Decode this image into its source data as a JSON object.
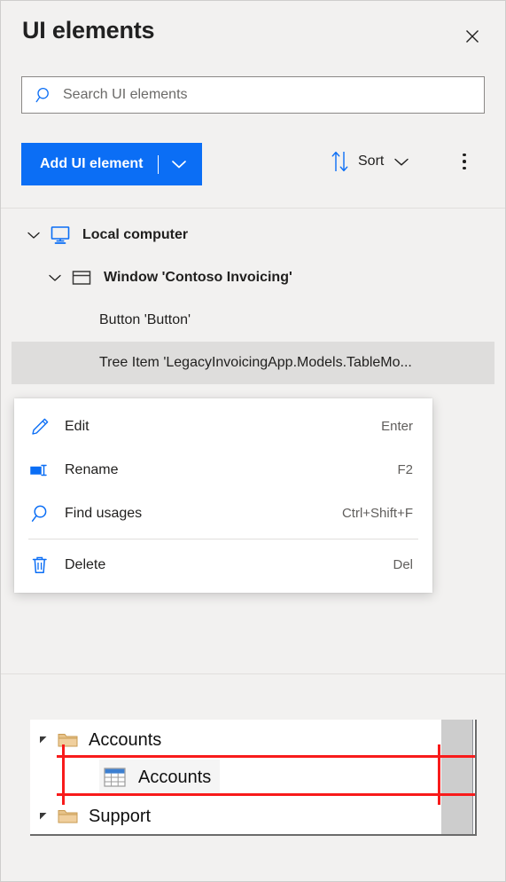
{
  "header": {
    "title": "UI elements",
    "close_icon": "close-icon"
  },
  "search": {
    "placeholder": "Search UI elements",
    "value": "",
    "icon": "search-icon"
  },
  "toolbar": {
    "add_label": "Add UI element",
    "add_caret_icon": "chevron-down-icon",
    "sort_label": "Sort",
    "sort_icon": "sort-arrows-icon",
    "sort_caret_icon": "chevron-down-icon",
    "more_icon": "more-vertical-icon",
    "accent_color": "#0b6ef5"
  },
  "tree": {
    "items": [
      {
        "label": "Local computer",
        "icon": "monitor-icon",
        "chevron": "chevron-down-icon",
        "depth": 0,
        "selected": false
      },
      {
        "label": "Window 'Contoso Invoicing'",
        "icon": "window-icon",
        "chevron": "chevron-down-icon",
        "depth": 1,
        "selected": false
      },
      {
        "label": "Button 'Button'",
        "icon": "",
        "chevron": "",
        "depth": 2,
        "selected": false
      },
      {
        "label": "Tree Item 'LegacyInvoicingApp.Models.TableMo...",
        "icon": "",
        "chevron": "",
        "depth": 2,
        "selected": true
      }
    ],
    "selected_bg": "#dedddc"
  },
  "context_menu": {
    "items": [
      {
        "label": "Edit",
        "shortcut": "Enter",
        "icon": "pencil-icon"
      },
      {
        "label": "Rename",
        "shortcut": "F2",
        "icon": "rename-icon"
      },
      {
        "label": "Find usages",
        "shortcut": "Ctrl+Shift+F",
        "icon": "search-icon"
      },
      {
        "label": "Delete",
        "shortcut": "Del",
        "icon": "trash-icon"
      }
    ],
    "separator_before_index": 3
  },
  "preview": {
    "rows": [
      {
        "label": "Accounts",
        "icon": "folder-icon",
        "expander": "triangle-expander-icon"
      },
      {
        "label": "Support",
        "icon": "folder-icon",
        "expander": "triangle-expander-icon"
      }
    ],
    "highlighted": {
      "label": "Accounts",
      "icon": "table-grid-icon"
    },
    "marker_color": "#f81b1b",
    "scrollbar_color": "#cdcdcd"
  }
}
